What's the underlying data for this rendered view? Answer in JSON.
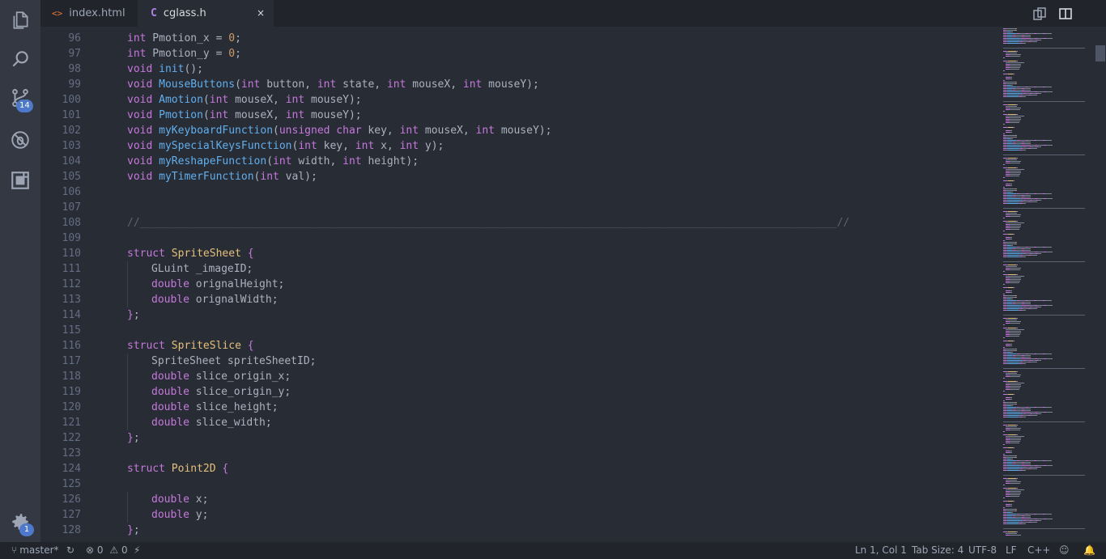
{
  "tabs": [
    {
      "icon": "<>",
      "label": "index.html"
    },
    {
      "icon": "C",
      "label": "cglass.h",
      "close": "×"
    }
  ],
  "activity_bar": {
    "scm_badge": "14",
    "settings_badge": "1"
  },
  "editor": {
    "lines": [
      {
        "n": "96",
        "indent": 1,
        "tokens": [
          [
            "kw",
            "int"
          ],
          [
            "pl",
            " Pmotion_x = "
          ],
          [
            "num",
            "0"
          ],
          [
            "pl",
            ";"
          ]
        ]
      },
      {
        "n": "97",
        "indent": 1,
        "tokens": [
          [
            "kw",
            "int"
          ],
          [
            "pl",
            " Pmotion_y = "
          ],
          [
            "num",
            "0"
          ],
          [
            "pl",
            ";"
          ]
        ]
      },
      {
        "n": "98",
        "indent": 1,
        "tokens": [
          [
            "kw",
            "void"
          ],
          [
            "pl",
            " "
          ],
          [
            "fn",
            "init"
          ],
          [
            "pl",
            "();"
          ]
        ]
      },
      {
        "n": "99",
        "indent": 1,
        "tokens": [
          [
            "kw",
            "void"
          ],
          [
            "pl",
            " "
          ],
          [
            "fn",
            "MouseButtons"
          ],
          [
            "pl",
            "("
          ],
          [
            "kw",
            "int"
          ],
          [
            "pl",
            " button, "
          ],
          [
            "kw",
            "int"
          ],
          [
            "pl",
            " state, "
          ],
          [
            "kw",
            "int"
          ],
          [
            "pl",
            " mouseX, "
          ],
          [
            "kw",
            "int"
          ],
          [
            "pl",
            " mouseY);"
          ]
        ]
      },
      {
        "n": "100",
        "indent": 1,
        "tokens": [
          [
            "kw",
            "void"
          ],
          [
            "pl",
            " "
          ],
          [
            "fn",
            "Amotion"
          ],
          [
            "pl",
            "("
          ],
          [
            "kw",
            "int"
          ],
          [
            "pl",
            " mouseX, "
          ],
          [
            "kw",
            "int"
          ],
          [
            "pl",
            " mouseY);"
          ]
        ]
      },
      {
        "n": "101",
        "indent": 1,
        "tokens": [
          [
            "kw",
            "void"
          ],
          [
            "pl",
            " "
          ],
          [
            "fn",
            "Pmotion"
          ],
          [
            "pl",
            "("
          ],
          [
            "kw",
            "int"
          ],
          [
            "pl",
            " mouseX, "
          ],
          [
            "kw",
            "int"
          ],
          [
            "pl",
            " mouseY);"
          ]
        ]
      },
      {
        "n": "102",
        "indent": 1,
        "tokens": [
          [
            "kw",
            "void"
          ],
          [
            "pl",
            " "
          ],
          [
            "fn",
            "myKeyboardFunction"
          ],
          [
            "pl",
            "("
          ],
          [
            "kw",
            "unsigned char"
          ],
          [
            "pl",
            " key, "
          ],
          [
            "kw",
            "int"
          ],
          [
            "pl",
            " mouseX, "
          ],
          [
            "kw",
            "int"
          ],
          [
            "pl",
            " mouseY);"
          ]
        ]
      },
      {
        "n": "103",
        "indent": 1,
        "tokens": [
          [
            "kw",
            "void"
          ],
          [
            "pl",
            " "
          ],
          [
            "fn",
            "mySpecialKeysFunction"
          ],
          [
            "pl",
            "("
          ],
          [
            "kw",
            "int"
          ],
          [
            "pl",
            " key, "
          ],
          [
            "kw",
            "int"
          ],
          [
            "pl",
            " x, "
          ],
          [
            "kw",
            "int"
          ],
          [
            "pl",
            " y);"
          ]
        ]
      },
      {
        "n": "104",
        "indent": 1,
        "tokens": [
          [
            "kw",
            "void"
          ],
          [
            "pl",
            " "
          ],
          [
            "fn",
            "myReshapeFunction"
          ],
          [
            "pl",
            "("
          ],
          [
            "kw",
            "int"
          ],
          [
            "pl",
            " width, "
          ],
          [
            "kw",
            "int"
          ],
          [
            "pl",
            " height);"
          ]
        ]
      },
      {
        "n": "105",
        "indent": 1,
        "tokens": [
          [
            "kw",
            "void"
          ],
          [
            "pl",
            " "
          ],
          [
            "fn",
            "myTimerFunction"
          ],
          [
            "pl",
            "("
          ],
          [
            "kw",
            "int"
          ],
          [
            "pl",
            " val);"
          ]
        ]
      },
      {
        "n": "106",
        "indent": 0,
        "tokens": []
      },
      {
        "n": "107",
        "indent": 0,
        "tokens": []
      },
      {
        "n": "108",
        "indent": 1,
        "tokens": [
          [
            "cm",
            "//______________________________________________________________________________________________________________//"
          ]
        ]
      },
      {
        "n": "109",
        "indent": 0,
        "tokens": []
      },
      {
        "n": "110",
        "indent": 1,
        "tokens": [
          [
            "kw",
            "struct"
          ],
          [
            "pl",
            " "
          ],
          [
            "ty",
            "SpriteSheet"
          ],
          [
            "pl",
            " "
          ],
          [
            "kw",
            "{"
          ]
        ]
      },
      {
        "n": "111",
        "indent": 2,
        "tokens": [
          [
            "pl",
            "GLuint _imageID;"
          ]
        ]
      },
      {
        "n": "112",
        "indent": 2,
        "tokens": [
          [
            "kw",
            "double"
          ],
          [
            "pl",
            " orignalHeight;"
          ]
        ]
      },
      {
        "n": "113",
        "indent": 2,
        "tokens": [
          [
            "kw",
            "double"
          ],
          [
            "pl",
            " orignalWidth;"
          ]
        ]
      },
      {
        "n": "114",
        "indent": 1,
        "tokens": [
          [
            "kw",
            "}"
          ],
          [
            "pl",
            ";"
          ]
        ]
      },
      {
        "n": "115",
        "indent": 0,
        "tokens": []
      },
      {
        "n": "116",
        "indent": 1,
        "tokens": [
          [
            "kw",
            "struct"
          ],
          [
            "pl",
            " "
          ],
          [
            "ty",
            "SpriteSlice"
          ],
          [
            "pl",
            " "
          ],
          [
            "kw",
            "{"
          ]
        ]
      },
      {
        "n": "117",
        "indent": 2,
        "tokens": [
          [
            "pl",
            "SpriteSheet spriteSheetID;"
          ]
        ]
      },
      {
        "n": "118",
        "indent": 2,
        "tokens": [
          [
            "kw",
            "double"
          ],
          [
            "pl",
            " slice_origin_x;"
          ]
        ]
      },
      {
        "n": "119",
        "indent": 2,
        "tokens": [
          [
            "kw",
            "double"
          ],
          [
            "pl",
            " slice_origin_y;"
          ]
        ]
      },
      {
        "n": "120",
        "indent": 2,
        "tokens": [
          [
            "kw",
            "double"
          ],
          [
            "pl",
            " slice_height;"
          ]
        ]
      },
      {
        "n": "121",
        "indent": 2,
        "tokens": [
          [
            "kw",
            "double"
          ],
          [
            "pl",
            " slice_width;"
          ]
        ]
      },
      {
        "n": "122",
        "indent": 1,
        "tokens": [
          [
            "kw",
            "}"
          ],
          [
            "pl",
            ";"
          ]
        ]
      },
      {
        "n": "123",
        "indent": 0,
        "tokens": []
      },
      {
        "n": "124",
        "indent": 1,
        "tokens": [
          [
            "kw",
            "struct"
          ],
          [
            "pl",
            " "
          ],
          [
            "ty",
            "Point2D"
          ],
          [
            "pl",
            " "
          ],
          [
            "kw",
            "{"
          ]
        ]
      },
      {
        "n": "125",
        "indent": 0,
        "tokens": []
      },
      {
        "n": "126",
        "indent": 2,
        "tokens": [
          [
            "kw",
            "double"
          ],
          [
            "pl",
            " x;"
          ]
        ]
      },
      {
        "n": "127",
        "indent": 2,
        "tokens": [
          [
            "kw",
            "double"
          ],
          [
            "pl",
            " y;"
          ]
        ]
      },
      {
        "n": "128",
        "indent": 1,
        "tokens": [
          [
            "kw",
            "}"
          ],
          [
            "pl",
            ";"
          ]
        ]
      }
    ]
  },
  "status_bar": {
    "branch": "master*",
    "errors": "0",
    "warnings": "0",
    "cursor": "Ln 1, Col 1",
    "tab_size": "Tab Size: 4",
    "encoding": "UTF-8",
    "eol": "LF",
    "language": "C++"
  },
  "colors": {
    "keyword": "#c678dd",
    "function": "#61afef",
    "number": "#d19a66",
    "type": "#e5c07b",
    "comment": "#5c6370",
    "accent": "#4d78cc"
  }
}
